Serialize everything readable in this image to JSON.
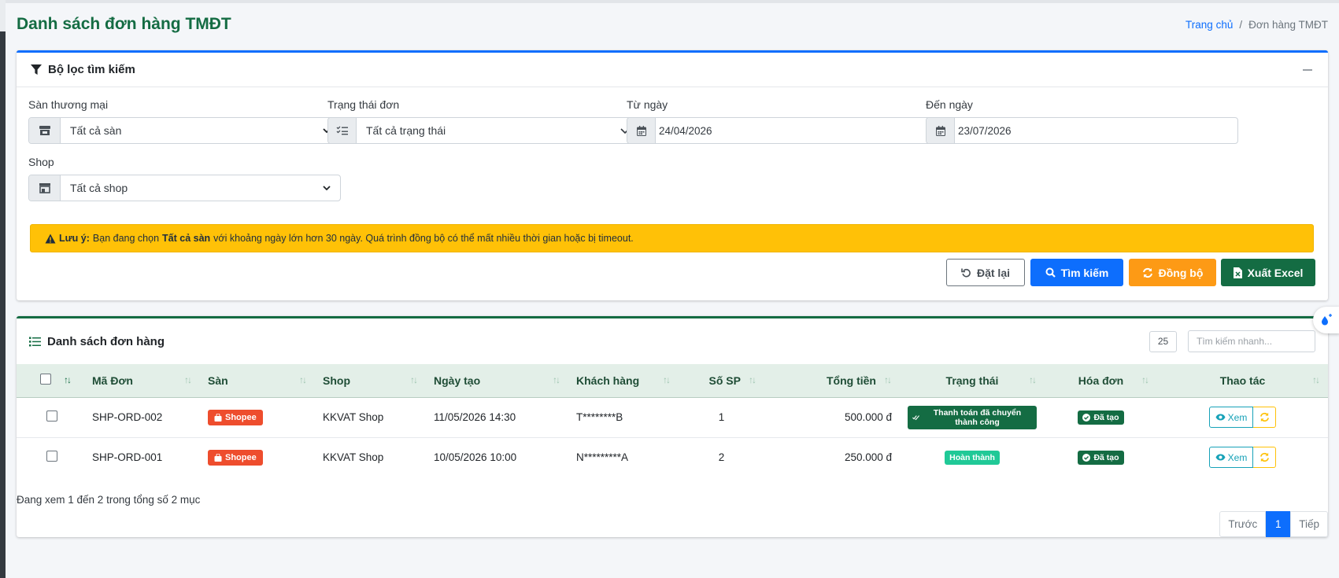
{
  "page": {
    "title": "Danh sách đơn hàng TMĐT"
  },
  "breadcrumb": {
    "home": "Trang chủ",
    "separator": "/",
    "current": "Đơn hàng TMĐT"
  },
  "filter": {
    "title": "Bộ lọc tìm kiếm",
    "marketplace": {
      "label": "Sàn thương mại",
      "value": "Tất cả sàn"
    },
    "status": {
      "label": "Trạng thái đơn",
      "value": "Tất cả trạng thái"
    },
    "from_date": {
      "label": "Từ ngày",
      "value": "24/04/2026"
    },
    "to_date": {
      "label": "Đến ngày",
      "value": "23/07/2026"
    },
    "shop": {
      "label": "Shop",
      "value": "Tất cả shop"
    }
  },
  "alert": {
    "strong_prefix": "Lưu ý:",
    "text_1": "Bạn đang chọn",
    "strong_mid": "Tất cả sàn",
    "text_2": "với khoảng ngày lớn hơn 30 ngày. Quá trình đồng bộ có thể mất nhiều thời gian hoặc bị timeout."
  },
  "buttons": {
    "reset": "Đặt lại",
    "search": "Tìm kiếm",
    "sync": "Đồng bộ",
    "export": "Xuất Excel"
  },
  "list": {
    "title": "Danh sách đơn hàng",
    "page_size": "25",
    "quick_search_placeholder": "Tìm kiếm nhanh...",
    "columns": [
      "Mã Đơn",
      "Sàn",
      "Shop",
      "Ngày tạo",
      "Khách hàng",
      "Số SP",
      "Tổng tiền",
      "Trạng thái",
      "Hóa đơn",
      "Thao tác"
    ],
    "rows": [
      {
        "code": "SHP-ORD-002",
        "market": "Shopee",
        "shop": "KKVAT Shop",
        "created": "11/05/2026 14:30",
        "customer": "T********B",
        "qty": "1",
        "total": "500.000 đ",
        "status": "Thanh toán đã chuyển thành công",
        "invoice": "Đã tạo",
        "view": "Xem"
      },
      {
        "code": "SHP-ORD-001",
        "market": "Shopee",
        "shop": "KKVAT Shop",
        "created": "10/05/2026 10:00",
        "customer": "N*********A",
        "qty": "2",
        "total": "250.000 đ",
        "status": "Hoàn thành",
        "invoice": "Đã tạo",
        "view": "Xem"
      }
    ],
    "info": "Đang xem 1 đến 2 trong tổng số 2 mục",
    "pager": {
      "prev": "Trước",
      "current": "1",
      "next": "Tiếp"
    }
  },
  "colors": {
    "primary": "#0d6efd",
    "success": "#146c43",
    "warning": "#ffc107",
    "orange": "#fd9a15",
    "shopee": "#ee4d2d",
    "teal": "#20c997"
  }
}
